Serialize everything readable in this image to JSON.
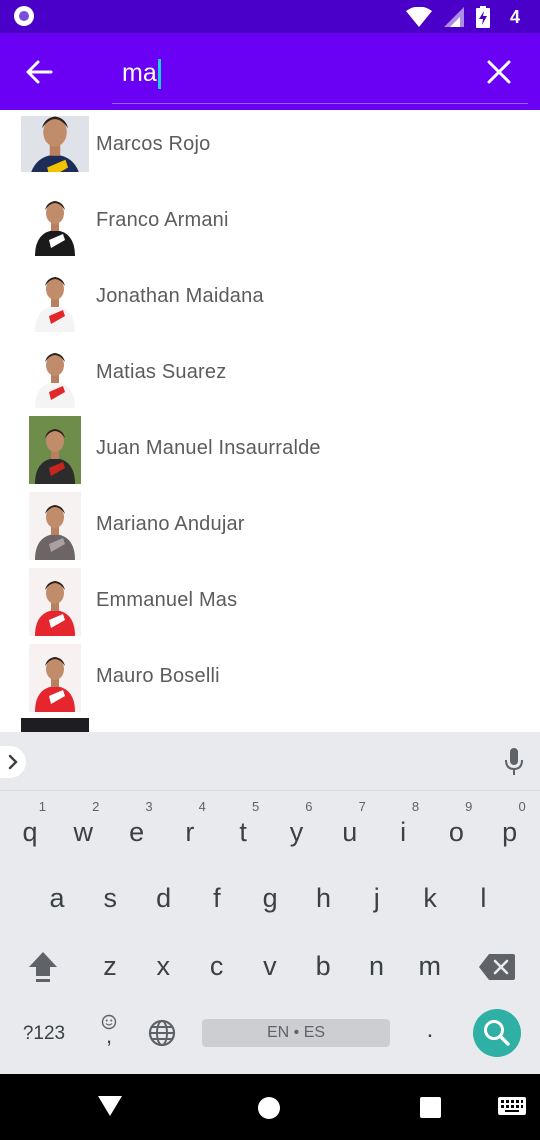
{
  "status_bar": {
    "time": "4"
  },
  "search": {
    "query": "ma"
  },
  "results": [
    {
      "name": "Marcos Rojo",
      "photo": {
        "bg": "#dfe2e8",
        "shirt": "#1e2c5a",
        "accent": "#f2c300"
      }
    },
    {
      "name": "Franco Armani",
      "photo": {
        "bg": "#ffffff",
        "shirt": "#1a1a1a",
        "accent": "#ffffff"
      }
    },
    {
      "name": "Jonathan Maidana",
      "photo": {
        "bg": "#ffffff",
        "shirt": "#f4f4f4",
        "accent": "#e2262a"
      }
    },
    {
      "name": "Matias Suarez",
      "photo": {
        "bg": "#ffffff",
        "shirt": "#f4f4f4",
        "accent": "#e2262a"
      }
    },
    {
      "name": "Juan Manuel Insaurralde",
      "photo": {
        "bg": "#6e8d4a",
        "shirt": "#2c2c2c",
        "accent": "#c8251f"
      }
    },
    {
      "name": "Mariano Andujar",
      "photo": {
        "bg": "#f6f2f2",
        "shirt": "#6d6466",
        "accent": "#a8a0a2"
      }
    },
    {
      "name": "Emmanuel Mas",
      "photo": {
        "bg": "#f7f1f1",
        "shirt": "#e5262e",
        "accent": "#ffffff"
      }
    },
    {
      "name": "Mauro Boselli",
      "photo": {
        "bg": "#f7f1f1",
        "shirt": "#e5262e",
        "accent": "#ffffff"
      }
    }
  ],
  "keyboard": {
    "row1": [
      {
        "k": "q",
        "h": "1"
      },
      {
        "k": "w",
        "h": "2"
      },
      {
        "k": "e",
        "h": "3"
      },
      {
        "k": "r",
        "h": "4"
      },
      {
        "k": "t",
        "h": "5"
      },
      {
        "k": "y",
        "h": "6"
      },
      {
        "k": "u",
        "h": "7"
      },
      {
        "k": "i",
        "h": "8"
      },
      {
        "k": "o",
        "h": "9"
      },
      {
        "k": "p",
        "h": "0"
      }
    ],
    "row2": [
      "a",
      "s",
      "d",
      "f",
      "g",
      "h",
      "j",
      "k",
      "l"
    ],
    "row3": [
      "z",
      "x",
      "c",
      "v",
      "b",
      "n",
      "m"
    ],
    "symbols_label": "?123",
    "comma": ",",
    "space_label": "EN • ES",
    "period": "."
  },
  "colors": {
    "status_bar": "#4a00c8",
    "toolbar": "#6a00f4",
    "cursor": "#18d4e8",
    "search_action": "#2fb0a4",
    "keyboard_bg": "#e8eaed"
  }
}
